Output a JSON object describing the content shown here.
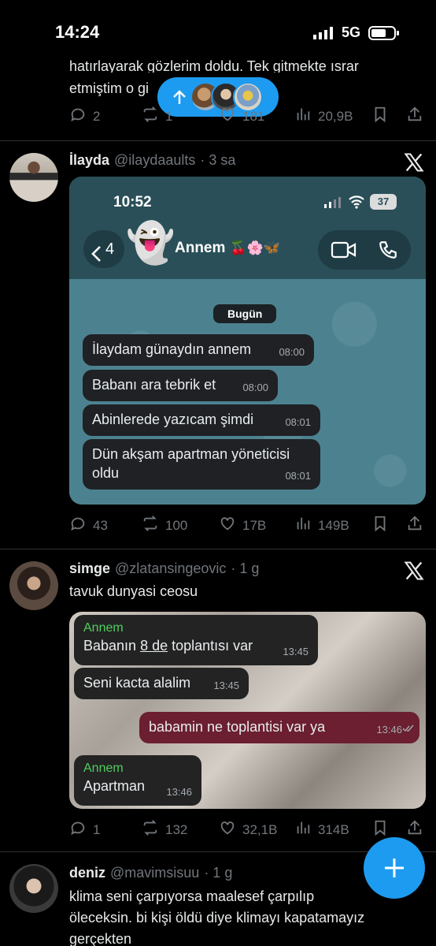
{
  "status_bar": {
    "time": "14:24",
    "network": "5G"
  },
  "post0": {
    "text_line1": "hatırlayarak gözlerim doldu. Tek gitmekte ısrar",
    "text_line2_start": "etmiştim o gi",
    "replies": "2",
    "reposts": "1",
    "likes": "181",
    "views": "20,9B"
  },
  "post1": {
    "name": "İlayda",
    "handle": "@ilaydaaults",
    "time": "· 3 sa",
    "replies": "43",
    "reposts": "100",
    "likes": "17B",
    "views": "149B",
    "image": {
      "clock": "10:52",
      "battery": "37",
      "back_count": "4",
      "contact": "Annem",
      "contact_emoji": "🍒🌸🦋",
      "ghost": "👻",
      "date_chip": "Bugün",
      "messages": [
        {
          "text": "İlaydam günaydın annem",
          "time": "08:00"
        },
        {
          "text": "Babanı ara tebrik et",
          "time": "08:00"
        },
        {
          "text": "Abinlerede yazıcam şimdi",
          "time": "08:01"
        },
        {
          "text_line1": "Dün akşam apartman yöneticisi",
          "text_line2": "oldu",
          "time": "08:01"
        }
      ]
    }
  },
  "post2": {
    "name": "simge",
    "handle": "@zlatansingeovic",
    "time": "· 1 g",
    "text": "tavuk dunyasi ceosu",
    "replies": "1",
    "reposts": "132",
    "likes": "32,1B",
    "views": "314B",
    "image": {
      "m1": {
        "sender": "Annem",
        "pre": "Babanın ",
        "underlined": "8 de",
        "post": " toplantısı var",
        "time": "13:45"
      },
      "m2": {
        "text": "Seni kacta alalim",
        "time": "13:45"
      },
      "m3": {
        "text": "babamin ne toplantisi var ya",
        "time": "13:46"
      },
      "m4": {
        "sender": "Annem",
        "text": "Apartman",
        "time": "13:46"
      }
    }
  },
  "post3": {
    "name": "deniz",
    "handle": "@mavimsisuu",
    "time": "· 1 g",
    "line1": "klima seni çarpıyorsa maalesef çarpılıp",
    "line2": "öleceksin. bi kişi öldü diye klimayı kapatamayız",
    "line3": "gerçekten"
  },
  "colors": {
    "accent": "#1d9bf0",
    "divider": "#2f3336",
    "muted": "#71767b"
  },
  "icons": [
    "reply-icon",
    "repost-icon",
    "like-icon",
    "views-icon",
    "bookmark-icon",
    "share-icon",
    "x-logo-icon",
    "compose-plus-icon",
    "arrow-up-icon"
  ]
}
